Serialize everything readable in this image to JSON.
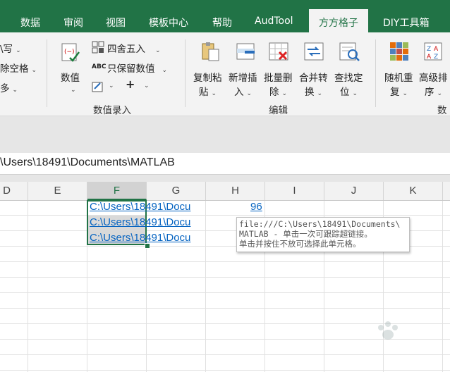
{
  "tabs": [
    "数据",
    "审阅",
    "视图",
    "模板中心",
    "帮助",
    "AudTool",
    "方方格子",
    "DIY工具箱"
  ],
  "active_tab": "方方格子",
  "ribbon": {
    "left_partial": [
      "\\写",
      "除空格",
      "多"
    ],
    "numeric_group": {
      "big_button": "数值",
      "round_label": "四舍五入",
      "keep_value_label": "只保留数值",
      "plus_label": "+",
      "group_label": "数值录入"
    },
    "edit_group": {
      "buttons": [
        {
          "line1": "复制粘",
          "line2": "贴"
        },
        {
          "line1": "新增插",
          "line2": "入"
        },
        {
          "line1": "批量删",
          "line2": "除"
        },
        {
          "line1": "合并转",
          "line2": "换"
        },
        {
          "line1": "查找定",
          "line2": "位"
        }
      ],
      "group_label": "编辑"
    },
    "right_group": {
      "buttons": [
        {
          "line1": "随机重",
          "line2": "复"
        },
        {
          "line1": "高级排",
          "line2": "序"
        }
      ],
      "group_label_partial": "数"
    }
  },
  "formula_bar": {
    "value": "\\Users\\18491\\Documents\\MATLAB"
  },
  "columns": [
    "D",
    "E",
    "F",
    "G",
    "H",
    "I",
    "J",
    "K"
  ],
  "selected_column": "F",
  "cells": {
    "links": [
      "C:\\Users\\18491\\Docu",
      "C:\\Users\\18491\\Docu",
      "C:\\Users\\18491\\Docu"
    ],
    "h1": "96"
  },
  "tooltip": {
    "lines": [
      "file:///C:\\Users\\18491\\Documents\\",
      "MATLAB - 单击一次可跟踪超链接。",
      "单击并按住不放可选择此单元格。"
    ]
  },
  "colors": {
    "excel_green": "#217346",
    "link_blue": "#0563c1"
  }
}
